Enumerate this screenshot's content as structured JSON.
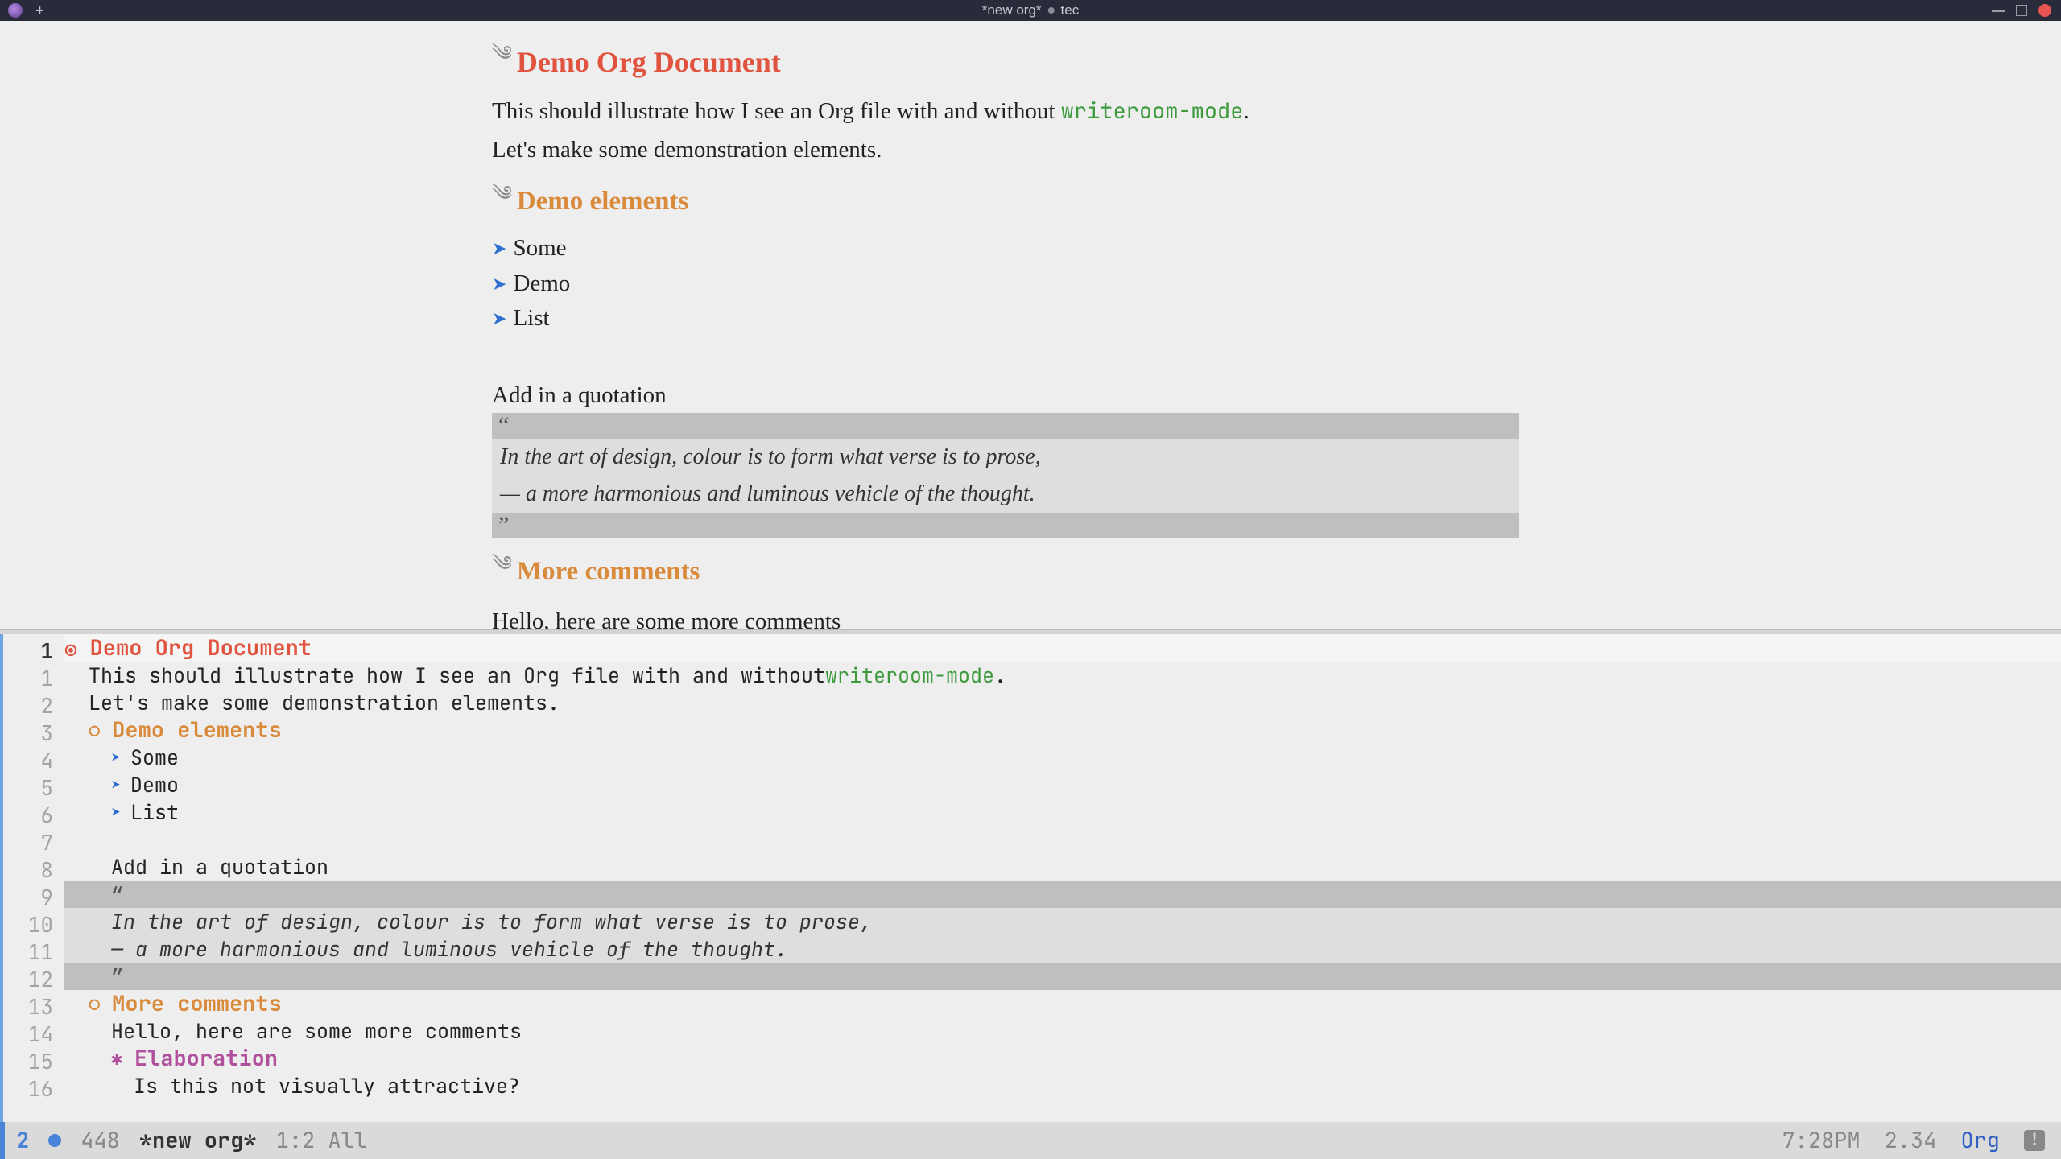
{
  "titlebar": {
    "buffer_name": "*new org*",
    "user": "tec"
  },
  "doc": {
    "h1": "Demo Org Document",
    "p1a": "This should illustrate how I see an Org file with and without ",
    "p1code": "writeroom-mode",
    "p1b": ".",
    "p2": "Let's make some demonstration elements.",
    "h2a": "Demo elements",
    "li1": "Some",
    "li2": "Demo",
    "li3": "List",
    "p3": "Add in a quotation",
    "quote_open": "“",
    "quote_l1": "In the art of design, colour is to form what verse is to prose,",
    "quote_l2": "— a more harmonious and luminous vehicle of the thought.",
    "quote_close": "”",
    "h2b": "More comments",
    "p4": "Hello, here are some more comments",
    "h3": "Elaboration",
    "p5": "Is this not visually attractive?"
  },
  "gutter": {
    "l1": "1",
    "l2": "1",
    "l3": "2",
    "l4": "3",
    "l5": "4",
    "l6": "5",
    "l7": "6",
    "l8": "7",
    "l9": "8",
    "l10": "9",
    "l11": "10",
    "l12": "11",
    "l13": "12",
    "l14": "13",
    "l15": "14",
    "l16": "15",
    "l17": "16"
  },
  "modeline": {
    "win": "2",
    "wc": "448",
    "buf": "*new org*",
    "pos": "1:2 All",
    "time": "7:28PM",
    "load": "2.34",
    "mode": "Org"
  }
}
